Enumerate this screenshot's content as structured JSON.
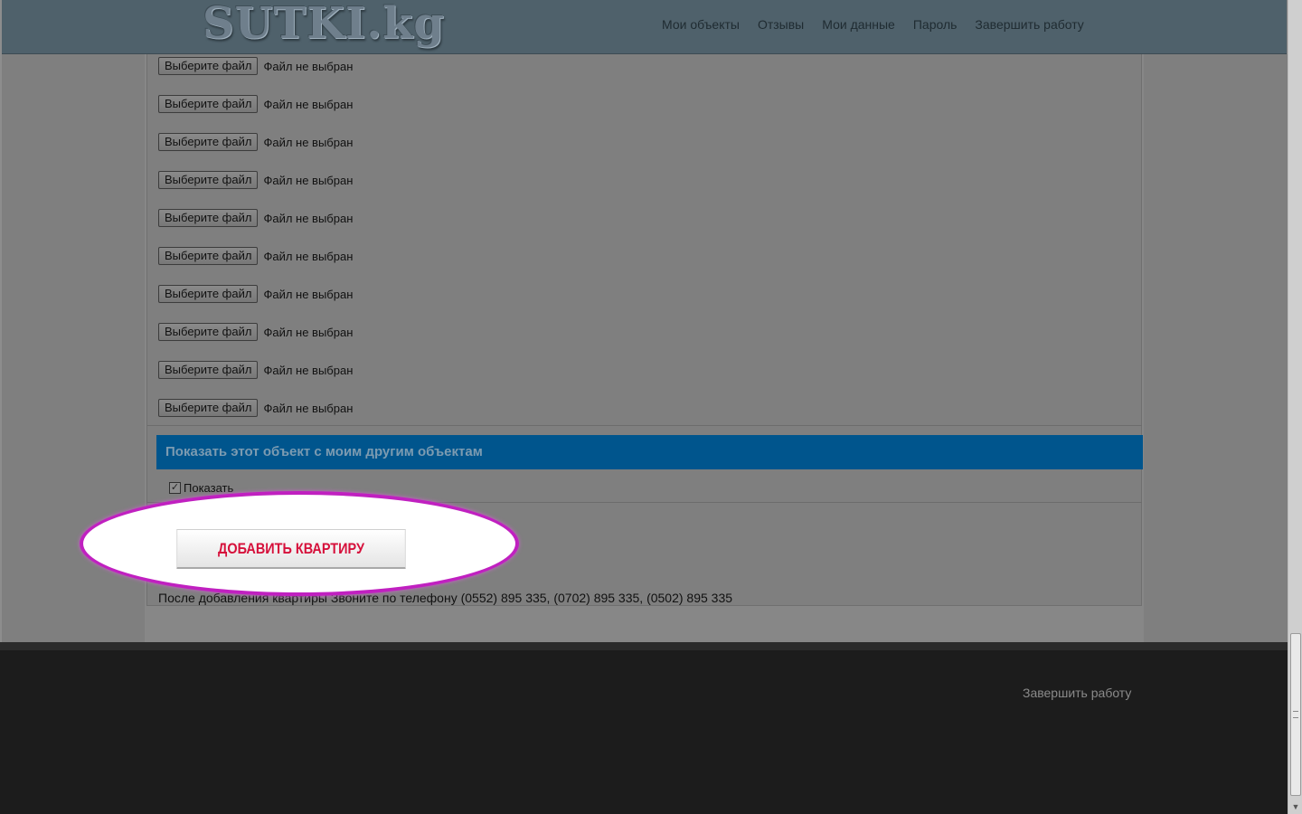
{
  "header": {
    "logo": "SUTKI.kg",
    "nav": [
      "Мои объекты",
      "Отзывы",
      "Мои данные",
      "Пароль",
      "Завершить работу"
    ]
  },
  "file_inputs": [
    {
      "button": "Выберите файл",
      "status": "Файл не выбран"
    },
    {
      "button": "Выберите файл",
      "status": "Файл не выбран"
    },
    {
      "button": "Выберите файл",
      "status": "Файл не выбран"
    },
    {
      "button": "Выберите файл",
      "status": "Файл не выбран"
    },
    {
      "button": "Выберите файл",
      "status": "Файл не выбран"
    },
    {
      "button": "Выберите файл",
      "status": "Файл не выбран"
    },
    {
      "button": "Выберите файл",
      "status": "Файл не выбран"
    },
    {
      "button": "Выберите файл",
      "status": "Файл не выбран"
    },
    {
      "button": "Выберите файл",
      "status": "Файл не выбран"
    },
    {
      "button": "Выберите файл",
      "status": "Файл не выбран"
    }
  ],
  "section": {
    "title": "Показать этот объект с моим другим объектам",
    "checkbox_label": "Показать",
    "checkbox_checked": true
  },
  "add_button": "ДОБАВИТЬ КВАРТИРУ",
  "note": "После добавления квартиры Звоните по телефону (0552) 895 335, (0702) 895 335, (0502) 895 335",
  "footer": {
    "logout": "Завершить работу"
  },
  "colors": {
    "section_bar": "#00558d",
    "add_button_text": "#d6103b",
    "highlight_border": "#c020c0"
  }
}
